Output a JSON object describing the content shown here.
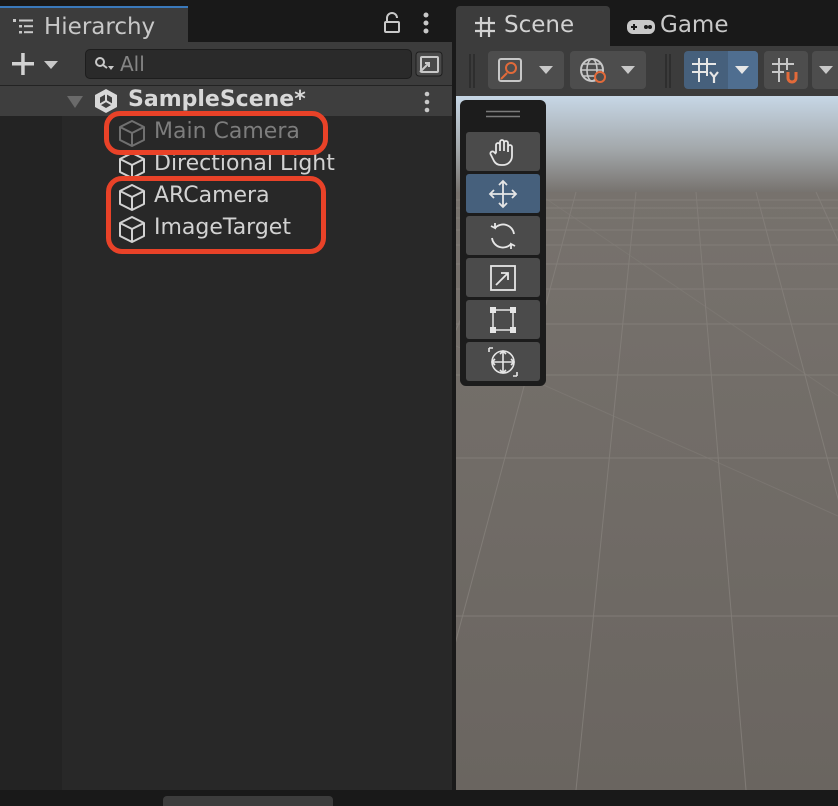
{
  "hierarchy": {
    "title": "Hierarchy",
    "search_placeholder": "All",
    "scene": {
      "name": "SampleScene*"
    },
    "items": [
      {
        "label": "Main Camera",
        "disabled": true,
        "icon": "gameobject-cube-icon"
      },
      {
        "label": "Directional Light",
        "disabled": false,
        "icon": "gameobject-cube-icon"
      },
      {
        "label": "ARCamera",
        "disabled": false,
        "icon": "gameobject-cube-icon"
      },
      {
        "label": "ImageTarget",
        "disabled": false,
        "icon": "gameobject-cube-icon"
      }
    ]
  },
  "scene_view": {
    "tabs": [
      {
        "label": "Scene",
        "active": true,
        "icon": "grid-hash-icon"
      },
      {
        "label": "Game",
        "active": false,
        "icon": "gamepad-icon"
      }
    ],
    "tools": [
      {
        "name": "hand-tool",
        "active": false
      },
      {
        "name": "move-tool",
        "active": true
      },
      {
        "name": "rotate-tool",
        "active": false
      },
      {
        "name": "scale-tool",
        "active": false
      },
      {
        "name": "rect-tool",
        "active": false
      },
      {
        "name": "transform-tool",
        "active": false
      }
    ]
  },
  "colors": {
    "highlight": "#e94228",
    "accent": "#3a79bb",
    "active_button": "#46607c",
    "panel": "#282828"
  }
}
